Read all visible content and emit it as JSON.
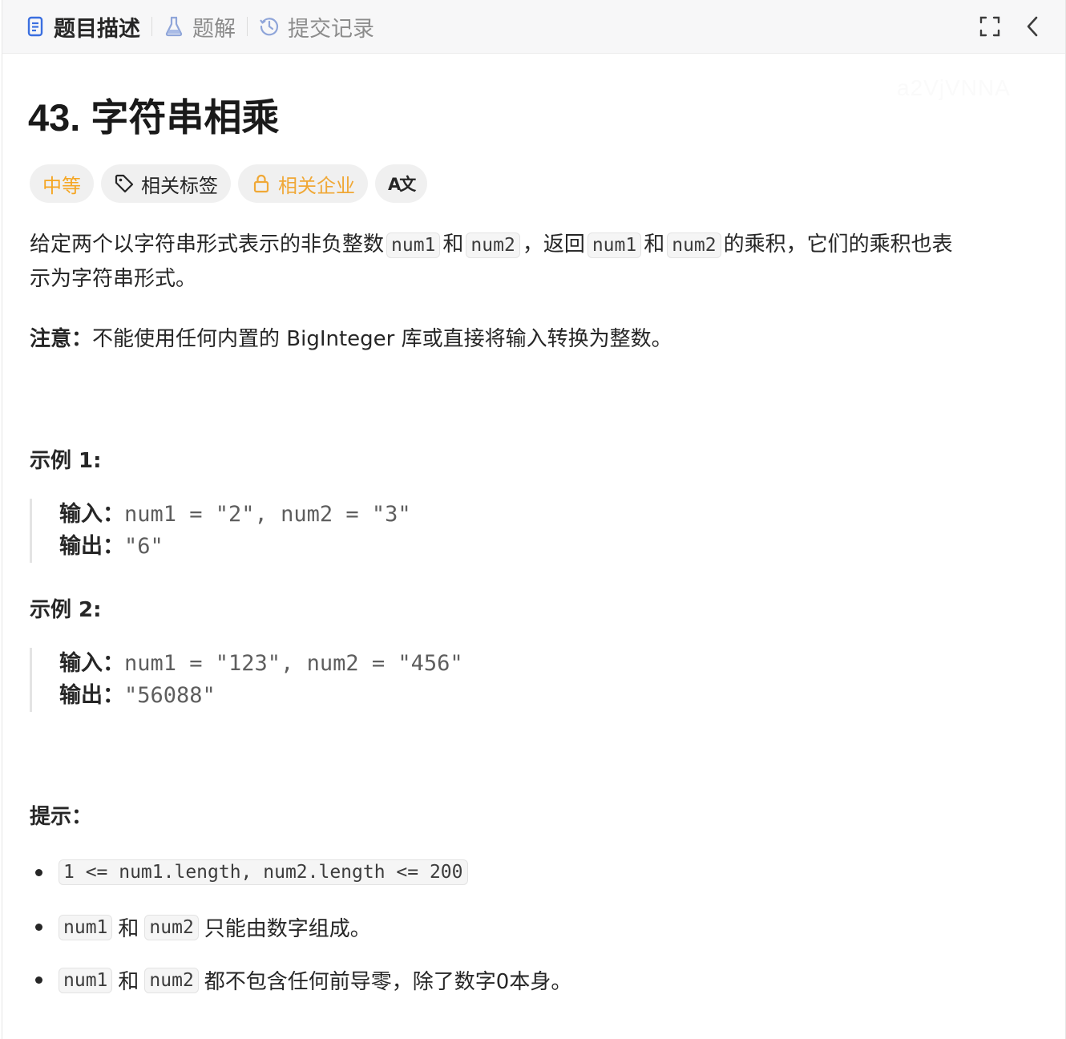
{
  "tabs": [
    {
      "label": "题目描述",
      "icon": "document-icon",
      "active": true
    },
    {
      "label": "题解",
      "icon": "flask-icon",
      "active": false
    },
    {
      "label": "提交记录",
      "icon": "history-icon",
      "active": false
    }
  ],
  "tools": {
    "fullscreen_icon": "expand-icon",
    "collapse_icon": "chevron-left-icon"
  },
  "watermark": "a2VjVNNA",
  "problem": {
    "title": "43. 字符串相乘",
    "tags": {
      "difficulty": "中等",
      "related_tags": "相关标签",
      "related_companies": "相关企业",
      "translate_glyph": "A文"
    },
    "description": {
      "p1_a": "给定两个以字符串形式表示的非负整数",
      "code_num1": "num1",
      "and": "和",
      "code_num2": "num2",
      "p1_b": "，返回",
      "p1_c": "的乘积，它们的乘积也表",
      "p1_d": "示为字符串形式。",
      "note_label": "注意：",
      "note_text": "不能使用任何内置的 BigInteger 库或直接将输入转换为整数。"
    },
    "examples": [
      {
        "title": "示例 1:",
        "input_label": "输入：",
        "input": "num1 = \"2\", num2 = \"3\"",
        "output_label": "输出：",
        "output": "\"6\""
      },
      {
        "title": "示例 2:",
        "input_label": "输入：",
        "input": "num1 = \"123\", num2 = \"456\"",
        "output_label": "输出：",
        "output": "\"56088\""
      }
    ],
    "hints_title": "提示：",
    "hints": {
      "h1_code": "1 <= num1.length, num2.length <= 200",
      "h2_text": "只能由数字组成。",
      "h3_text": "都不包含任何前导零，除了数字0本身。"
    }
  },
  "colors": {
    "difficulty_medium": "#f5a623",
    "active_tab_icon": "#3b6fe0",
    "inactive_icon": "#8fa5d9"
  }
}
